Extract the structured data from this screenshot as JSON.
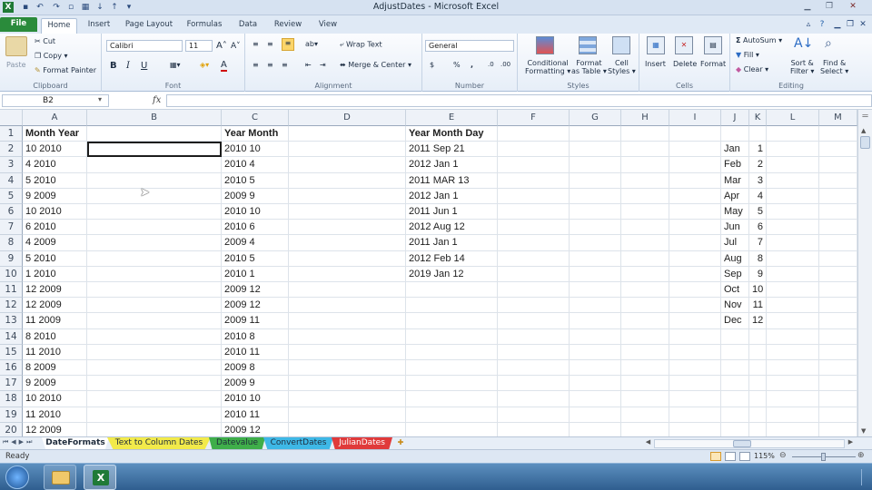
{
  "window": {
    "title": "AdjustDates - Microsoft Excel"
  },
  "ribbon_tabs": [
    "File",
    "Home",
    "Insert",
    "Page Layout",
    "Formulas",
    "Data",
    "Review",
    "View"
  ],
  "ribbon": {
    "clipboard": {
      "paste": "Paste",
      "cut": "Cut",
      "copy": "Copy",
      "format_painter": "Format Painter",
      "label": "Clipboard"
    },
    "font": {
      "name": "Calibri",
      "size": "11",
      "bold": "B",
      "italic": "I",
      "underline": "U",
      "label": "Font"
    },
    "alignment": {
      "wrap_text": "Wrap Text",
      "merge_center": "Merge & Center",
      "label": "Alignment"
    },
    "number": {
      "format": "General",
      "currency": "$",
      "percent": "%",
      "comma": ",",
      "label": "Number"
    },
    "styles": {
      "conditional_1": "Conditional",
      "conditional_2": "Formatting",
      "format_table_1": "Format",
      "format_table_2": "as Table",
      "cell_styles_1": "Cell",
      "cell_styles_2": "Styles",
      "label": "Styles"
    },
    "cells": {
      "insert": "Insert",
      "delete": "Delete",
      "format": "Format",
      "label": "Cells"
    },
    "editing": {
      "autosum": "AutoSum",
      "fill": "Fill",
      "clear": "Clear",
      "sort_1": "Sort &",
      "sort_2": "Filter",
      "find_1": "Find &",
      "find_2": "Select",
      "label": "Editing"
    }
  },
  "formula_bar": {
    "name_box": "B2",
    "fx": "fx",
    "formula": ""
  },
  "columns": [
    "A",
    "B",
    "C",
    "D",
    "E",
    "F",
    "G",
    "H",
    "I",
    "J",
    "K",
    "L",
    "M"
  ],
  "rows": [
    "1",
    "2",
    "3",
    "4",
    "5",
    "6",
    "7",
    "8",
    "9",
    "10",
    "11",
    "12",
    "13",
    "14",
    "15",
    "16",
    "17",
    "18",
    "19",
    "20"
  ],
  "col_a": [
    "Month Year",
    "10 2010",
    "4 2010",
    "5 2010",
    "9 2009",
    "10 2010",
    "6 2010",
    "4 2009",
    "5 2010",
    "1 2010",
    "12 2009",
    "12 2009",
    "11 2009",
    "8 2010",
    "11 2010",
    "8 2009",
    "9 2009",
    "10 2010",
    "11 2010",
    "12 2009"
  ],
  "col_c": [
    "Year Month",
    "2010 10",
    "2010 4",
    "2010 5",
    "2009 9",
    "2010 10",
    "2010 6",
    "2009 4",
    "2010 5",
    "2010 1",
    "2009 12",
    "2009 12",
    "2009 11",
    "2010 8",
    "2010 11",
    "2009 8",
    "2009 9",
    "2010 10",
    "2010 11",
    "2009 12"
  ],
  "col_e": [
    "Year Month Day",
    "2011 Sep 21",
    "2012 Jan 1",
    "2011 MAR 13",
    "2012 Jan 1",
    "2011 Jun 1",
    "2012 Aug 12",
    "2011 Jan 1",
    "2012 Feb 14",
    "2019 Jan 12"
  ],
  "col_j": [
    "",
    "Jan",
    "Feb",
    "Mar",
    "Apr",
    "May",
    "Jun",
    "Jul",
    "Aug",
    "Sep",
    "Oct",
    "Nov",
    "Dec"
  ],
  "col_k": [
    "",
    "1",
    "2",
    "3",
    "4",
    "5",
    "6",
    "7",
    "8",
    "9",
    "10",
    "11",
    "12"
  ],
  "sheet_tabs": [
    {
      "name": "DateFormats",
      "color": "#ffffff"
    },
    {
      "name": "Text to Column Dates",
      "color": "#f2ea4a"
    },
    {
      "name": "Datevalue",
      "color": "#3fae4a"
    },
    {
      "name": "ConvertDates",
      "color": "#3eb8e6"
    },
    {
      "name": "JulianDates",
      "color": "#e03a3a"
    }
  ],
  "status": {
    "ready": "Ready",
    "zoom": "115%"
  }
}
